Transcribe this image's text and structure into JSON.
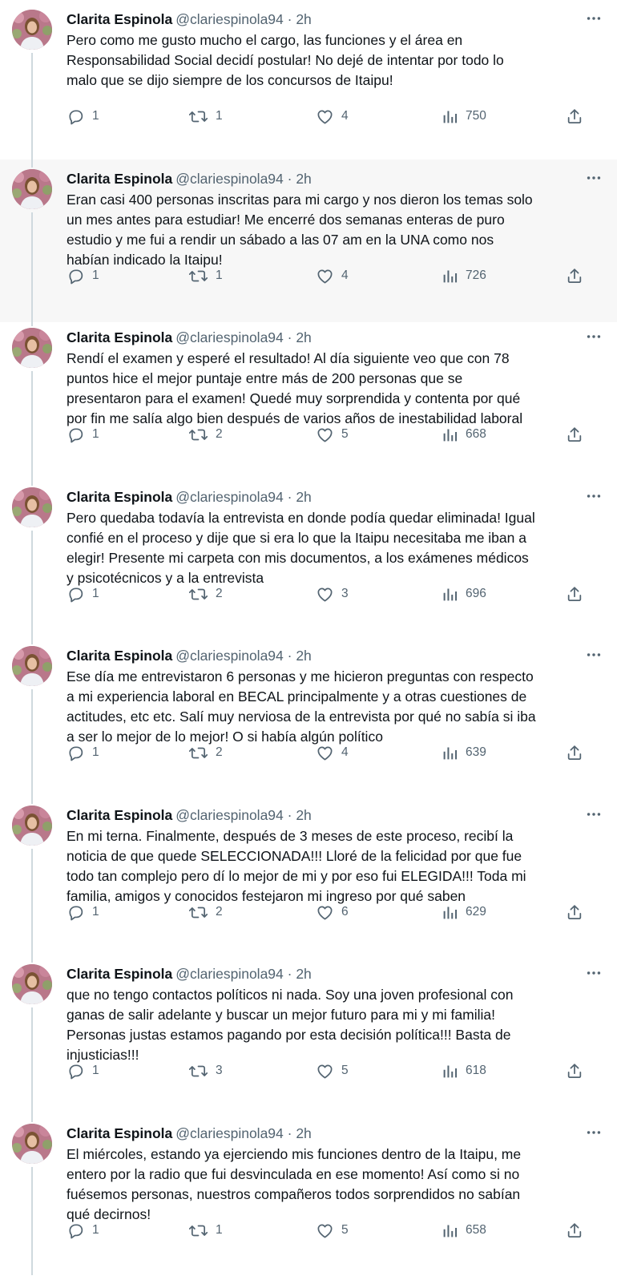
{
  "colors": {
    "text": "#0f1419",
    "secondary": "#536471",
    "thread_line": "#cfd9de"
  },
  "icons": {
    "avatar": "profile-photo",
    "more": "more-dots-icon",
    "reply": "reply-icon",
    "retweet": "retweet-icon",
    "like": "heart-icon",
    "views": "views-chart-icon",
    "share": "share-icon"
  },
  "tweets": [
    {
      "name": "Clarita Espinola",
      "handle": "@clariespinola94 · 2h",
      "lines": [
        "Pero como me gusto mucho el cargo, las funciones y el área en",
        "Responsabilidad Social decidí postular! No dejé de intentar por todo lo",
        "malo que se dijo siempre de los concursos de Itaipu!"
      ],
      "replies": "1",
      "retweets": "1",
      "likes": "4",
      "views": "750"
    },
    {
      "name": "Clarita Espinola",
      "handle": "@clariespinola94 · 2h",
      "lines": [
        "Eran casi 400 personas inscritas para mi cargo y nos dieron los temas solo",
        "un mes antes para estudiar! Me encerré dos semanas enteras de puro",
        "estudio y me fui a rendir un sábado a las 07 am en la UNA como nos",
        "habían indicado la Itaipu!"
      ],
      "replies": "1",
      "retweets": "1",
      "likes": "4",
      "views": "726"
    },
    {
      "name": "Clarita Espinola",
      "handle": "@clariespinola94 · 2h",
      "lines": [
        "Rendí el examen y esperé el resultado! Al día siguiente veo que con 78",
        "puntos hice el mejor puntaje entre más de 200 personas que se",
        "presentaron para el examen! Quedé muy sorprendida y contenta por qué",
        "por fin me salía algo bien después de varios años de inestabilidad laboral"
      ],
      "replies": "1",
      "retweets": "2",
      "likes": "5",
      "views": "668"
    },
    {
      "name": "Clarita Espinola",
      "handle": "@clariespinola94 · 2h",
      "lines": [
        "Pero quedaba todavía la entrevista en donde podía quedar eliminada! Igual",
        "confié en el proceso y dije que si era lo que la Itaipu necesitaba me iban a",
        "elegir! Presente mi carpeta con mis documentos, a los exámenes médicos",
        "y psicotécnicos y a la entrevista"
      ],
      "replies": "1",
      "retweets": "2",
      "likes": "3",
      "views": "696"
    },
    {
      "name": "Clarita Espinola",
      "handle": "@clariespinola94 · 2h",
      "lines": [
        "Ese día me entrevistaron 6 personas y me hicieron preguntas con respecto",
        "a mi experiencia laboral en BECAL principalmente y a otras cuestiones de",
        "actitudes, etc etc. Salí muy nerviosa de la entrevista por qué no sabía si iba",
        "a ser lo mejor de lo mejor! O si había algún político"
      ],
      "replies": "1",
      "retweets": "2",
      "likes": "4",
      "views": "639"
    },
    {
      "name": "Clarita Espinola",
      "handle": "@clariespinola94 · 2h",
      "lines": [
        "En mi terna. Finalmente, después de 3 meses de este proceso, recibí la",
        "noticia de que quede SELECCIONADA!!! Lloré de la felicidad por que fue",
        "todo tan complejo pero dí lo mejor de mi y por eso fui ELEGIDA!!! Toda mi",
        "familia, amigos y conocidos festejaron mi ingreso por qué saben"
      ],
      "replies": "1",
      "retweets": "2",
      "likes": "6",
      "views": "629"
    },
    {
      "name": "Clarita Espinola",
      "handle": "@clariespinola94 · 2h",
      "lines": [
        "que no tengo contactos políticos ni nada. Soy una  joven profesional con",
        "ganas de salir adelante y buscar un mejor futuro para mi y mi familia!",
        "Personas justas estamos pagando por esta decisión política!!! Basta de",
        "injusticias!!!"
      ],
      "replies": "1",
      "retweets": "3",
      "likes": "5",
      "views": "618"
    },
    {
      "name": "Clarita Espinola",
      "handle": "@clariespinola94 · 2h",
      "lines": [
        "El miércoles, estando ya ejerciendo mis funciones dentro de la Itaipu, me",
        "entero por la radio que fui desvinculada en ese momento! Así como si no",
        "fuésemos personas, nuestros compañeros todos sorprendidos no sabían",
        "qué decirnos!"
      ],
      "replies": "1",
      "retweets": "1",
      "likes": "5",
      "views": "658"
    }
  ]
}
